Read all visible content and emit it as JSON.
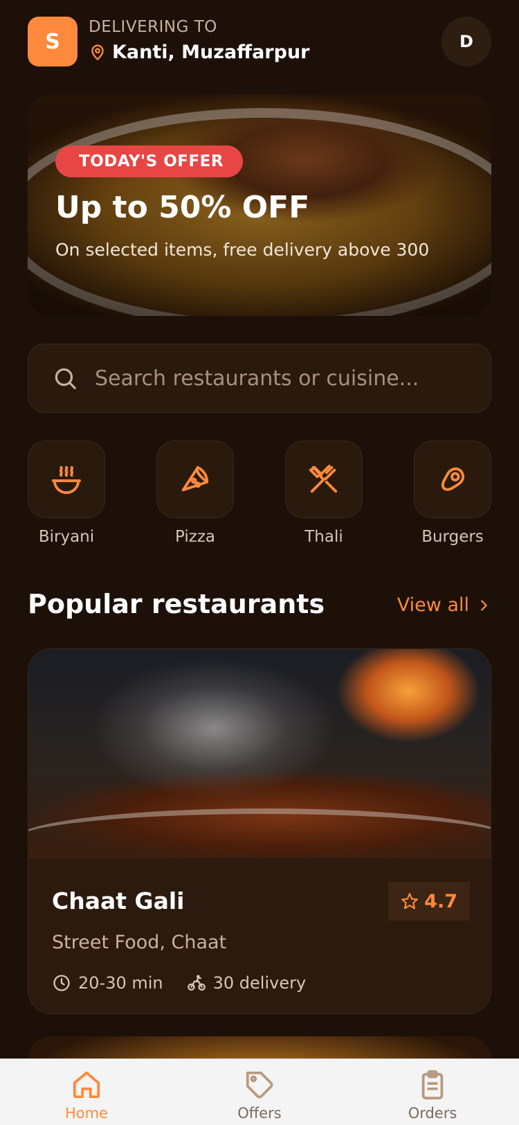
{
  "header": {
    "logo_letter": "S",
    "deliver_label": "DELIVERING TO",
    "location": "Kanti, Muzaffarpur",
    "avatar_letter": "D"
  },
  "banner": {
    "badge": "TODAY'S OFFER",
    "title": "Up to 50% OFF",
    "subtitle": "On selected items, free delivery above   300"
  },
  "search": {
    "placeholder": "Search restaurants or cuisine..."
  },
  "categories": [
    {
      "label": "Biryani",
      "icon": "bowl-steam-icon"
    },
    {
      "label": "Pizza",
      "icon": "pizza-slice-icon"
    },
    {
      "label": "Thali",
      "icon": "utensils-crossed-icon"
    },
    {
      "label": "Burgers",
      "icon": "meat-icon"
    }
  ],
  "section": {
    "title": "Popular restaurants",
    "view_all": "View all"
  },
  "restaurants": [
    {
      "name": "Chaat Gali",
      "rating": "4.7",
      "cuisine": "Street Food, Chaat",
      "time": "20-30 min",
      "delivery": "30 delivery"
    }
  ],
  "tabs": [
    {
      "label": "Home",
      "icon": "home-icon",
      "active": true
    },
    {
      "label": "Offers",
      "icon": "tag-icon",
      "active": false
    },
    {
      "label": "Orders",
      "icon": "clipboard-icon",
      "active": false
    }
  ],
  "colors": {
    "background": "#1c1008",
    "accent": "#ff8a3d",
    "badge": "#e84545",
    "surface": "#2a1a0e"
  }
}
